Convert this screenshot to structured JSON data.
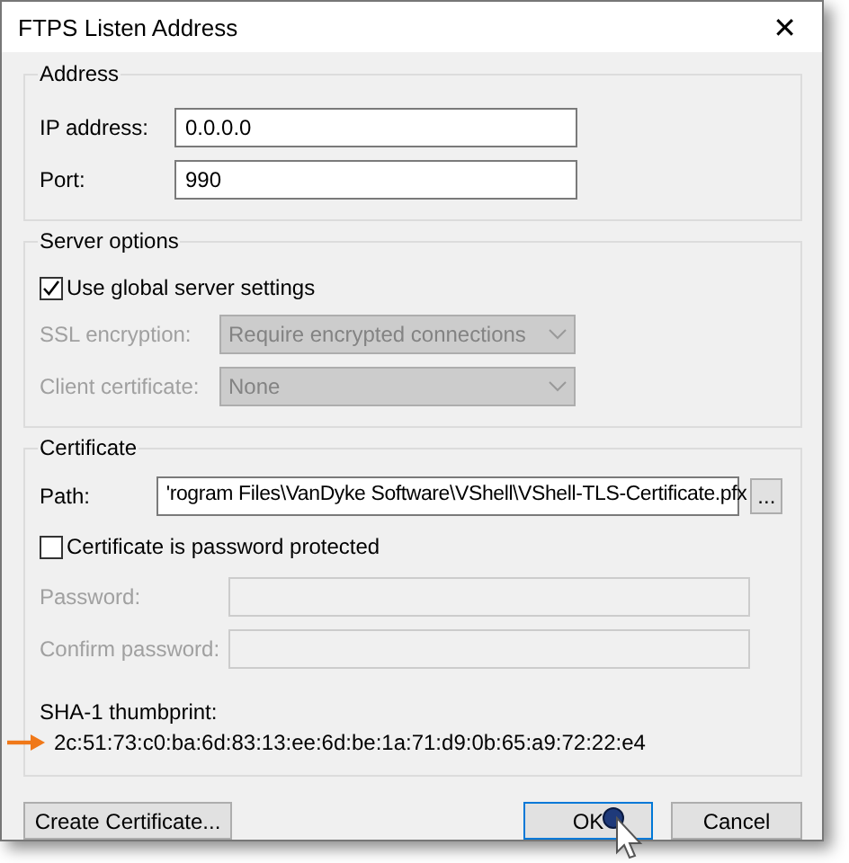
{
  "window": {
    "title": "FTPS Listen Address",
    "close": "✕"
  },
  "address": {
    "title": "Address",
    "fields": [
      {
        "label": "IP address:",
        "value": "0.0.0.0"
      },
      {
        "label": "Port:",
        "value": "990"
      }
    ]
  },
  "server_options": {
    "title": "Server options",
    "checkbox": {
      "label": "Use global server settings",
      "checked": true
    },
    "dropdowns": [
      {
        "label": "SSL encryption:",
        "value": "Require encrypted connections",
        "disabled": true
      },
      {
        "label": "Client certificate:",
        "value": "None",
        "disabled": true
      }
    ]
  },
  "certificate": {
    "title": "Certificate",
    "path": {
      "label": "Path:",
      "value": "'rogram Files\\VanDyke Software\\VShell\\VShell-TLS-Certificate.pfx"
    },
    "browse_button": "...",
    "checkbox": {
      "label": "Certificate is password protected",
      "checked": false
    },
    "password_fields": [
      {
        "label": "Password:",
        "disabled": true
      },
      {
        "label": "Confirm  password:",
        "disabled": true
      }
    ],
    "thumbprint_label": "SHA-1 thumbprint:",
    "thumbprint": "2c:51:73:c0:ba:6d:83:13:ee:6d:be:1a:71:d9:0b:65:a9:72:22:e4"
  },
  "buttons": [
    {
      "label": "Create Certificate...",
      "kind": "left"
    },
    {
      "label": "OK",
      "kind": "default"
    },
    {
      "label": "Cancel",
      "kind": "normal"
    }
  ]
}
